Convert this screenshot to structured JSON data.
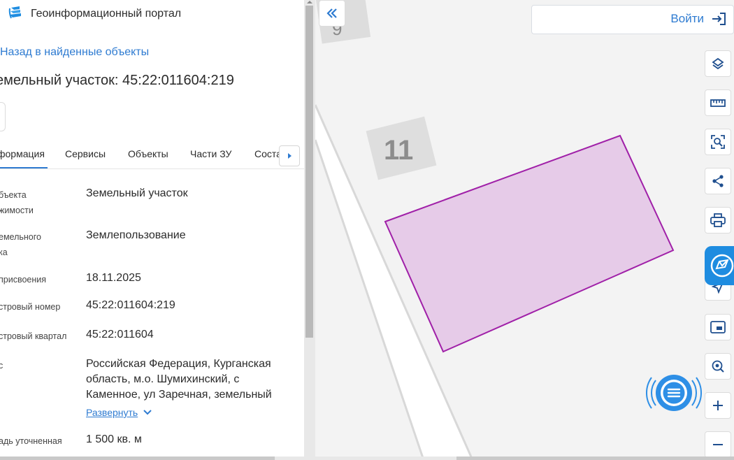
{
  "app": {
    "title": "Геоинформационный портал",
    "logo_icon": "portal-logo-icon"
  },
  "nav": {
    "back_link": "Назад в найденные объекты"
  },
  "object": {
    "title": "емельный участок: 45:22:011604:219"
  },
  "tabs": [
    {
      "label": "формация",
      "active": true
    },
    {
      "label": "Сервисы",
      "active": false
    },
    {
      "label": "Объекты",
      "active": false
    },
    {
      "label": "Части ЗУ",
      "active": false
    },
    {
      "label": "Соста",
      "active": false
    }
  ],
  "details": [
    {
      "label_lines": [
        "бъекта",
        "жимости"
      ],
      "value": "Земельный участок"
    },
    {
      "label_lines": [
        "емельного",
        "ка"
      ],
      "value": "Землепользование"
    },
    {
      "label_lines": [
        "присвоения"
      ],
      "value": "18.11.2025"
    },
    {
      "label_lines": [
        "стровый номер"
      ],
      "value": "45:22:011604:219"
    },
    {
      "label_lines": [
        "стровый квартал"
      ],
      "value": "45:22:011604"
    },
    {
      "label_lines": [
        "с"
      ],
      "value": "Российская Федерация, Курганская область, м.о. Шумихинский, с Каменное, ул Заречная, земельный"
    },
    {
      "label_lines": [
        "адь уточненная"
      ],
      "value": "1 500 кв. м"
    }
  ],
  "expand_link": "Развернуть",
  "map": {
    "house_numbers": [
      "11",
      "9"
    ],
    "parcel_fill": "#e6cbe8",
    "parcel_stroke": "#a020a8"
  },
  "header": {
    "login_label": "Войти"
  },
  "tools": [
    {
      "name": "layers-icon"
    },
    {
      "name": "ruler-icon"
    },
    {
      "name": "select-area-icon"
    },
    {
      "name": "share-icon"
    },
    {
      "name": "print-icon"
    },
    {
      "name": "navigation-icon"
    },
    {
      "name": "minimap-icon"
    },
    {
      "name": "location-search-icon"
    },
    {
      "name": "zoom-in-icon"
    },
    {
      "name": "zoom-out-icon"
    }
  ],
  "colors": {
    "accent": "#2e7bd1",
    "brand": "#1e8ce0"
  }
}
